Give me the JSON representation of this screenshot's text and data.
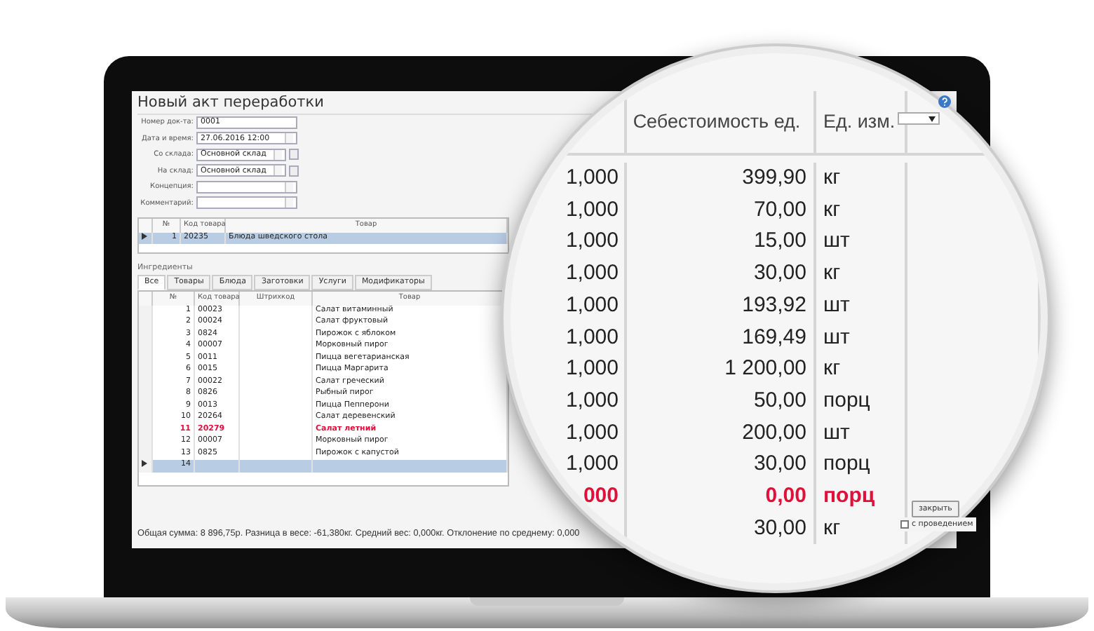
{
  "window": {
    "title": "Новый акт переработки"
  },
  "form": [
    {
      "label": "Номер док-та:",
      "value": "0001",
      "kind": "text"
    },
    {
      "label": "Дата и время:",
      "value": "27.06.2016 12:00",
      "kind": "combo"
    },
    {
      "label": "Со склада:",
      "value": "Основной склад",
      "kind": "lookup"
    },
    {
      "label": "На склад:",
      "value": "Основной склад",
      "kind": "lookup"
    },
    {
      "label": "Концепция:",
      "kind": "combo"
    },
    {
      "label": "Комментарий:",
      "kind": "combo"
    }
  ],
  "products": {
    "columns": [
      "№",
      "Код товара",
      "Товар"
    ],
    "rows": [
      {
        "cells": [
          "1",
          "20235",
          "Блюда шведского стола"
        ],
        "selected": true
      }
    ]
  },
  "ingredients": {
    "title": "Ингредиенты",
    "tabs": [
      {
        "label": "Все",
        "selected": true
      },
      {
        "label": "Товары",
        "selected": false
      },
      {
        "label": "Блюда",
        "selected": false
      },
      {
        "label": "Заготовки",
        "selected": false
      },
      {
        "label": "Услуги",
        "selected": false
      },
      {
        "label": "Модификаторы",
        "selected": false
      }
    ],
    "columns": [
      "№",
      "Код товара",
      "Штрихкод",
      "Товар"
    ],
    "rows": [
      {
        "number": "1",
        "code": "00023",
        "name": "Салат витаминный",
        "highlighted": false,
        "selected": false
      },
      {
        "number": "2",
        "code": "00024",
        "name": "Салат фруктовый",
        "highlighted": false,
        "selected": false
      },
      {
        "number": "3",
        "code": "0824",
        "name": "Пирожок с яблоком",
        "highlighted": false,
        "selected": false
      },
      {
        "number": "4",
        "code": "00007",
        "name": "Морковный пирог",
        "highlighted": false,
        "selected": false
      },
      {
        "number": "5",
        "code": "0011",
        "name": "Пицца вегетарианская",
        "highlighted": false,
        "selected": false
      },
      {
        "number": "6",
        "code": "0015",
        "name": "Пицца Маргарита",
        "highlighted": false,
        "selected": false
      },
      {
        "number": "7",
        "code": "00022",
        "name": "Салат греческий",
        "highlighted": false,
        "selected": false
      },
      {
        "number": "8",
        "code": "0826",
        "name": "Рыбный пирог",
        "highlighted": false,
        "selected": false
      },
      {
        "number": "9",
        "code": "0013",
        "name": "Пицца Пепперони",
        "highlighted": false,
        "selected": false
      },
      {
        "number": "10",
        "code": "20264",
        "name": "Салат деревенский",
        "highlighted": false,
        "selected": false
      },
      {
        "number": "11",
        "code": "20279",
        "name": "Салат летний",
        "highlighted": true,
        "selected": false
      },
      {
        "number": "12",
        "code": "00007",
        "name": "Морковный пирог",
        "highlighted": false,
        "selected": false
      },
      {
        "number": "13",
        "code": "0825",
        "name": "Пирожок с капустой",
        "highlighted": false,
        "selected": false
      },
      {
        "number": "14",
        "selected": true,
        "highlighted": false
      }
    ]
  },
  "status_bar": "Общая сумма: 8 896,75р. Разница в весе: -61,380кг. Средний вес: 0,000кг. Отклонение по среднему: 0,000",
  "footer": {
    "close_button": "закрыть",
    "post_checkbox": {
      "label": "с проведением",
      "checked": false
    }
  },
  "magnifier": {
    "columns": [
      "Себестоимость ед.",
      "Ед. изм."
    ],
    "rows": [
      {
        "quantity": "1,000",
        "cost": "399,90",
        "unit": "кг",
        "highlighted": false
      },
      {
        "quantity": "1,000",
        "cost": "70,00",
        "unit": "кг",
        "highlighted": false
      },
      {
        "quantity": "1,000",
        "cost": "15,00",
        "unit": "шт",
        "highlighted": false
      },
      {
        "quantity": "1,000",
        "cost": "30,00",
        "unit": "кг",
        "highlighted": false
      },
      {
        "quantity": "1,000",
        "cost": "193,92",
        "unit": "шт",
        "highlighted": false
      },
      {
        "quantity": "1,000",
        "cost": "169,49",
        "unit": "шт",
        "highlighted": false
      },
      {
        "quantity": "1,000",
        "cost": "1 200,00",
        "unit": "кг",
        "highlighted": false
      },
      {
        "quantity": "1,000",
        "cost": "50,00",
        "unit": "порц",
        "highlighted": false
      },
      {
        "quantity": "1,000",
        "cost": "200,00",
        "unit": "шт",
        "highlighted": false
      },
      {
        "quantity": "1,000",
        "cost": "30,00",
        "unit": "порц",
        "highlighted": false
      },
      {
        "quantity": "000",
        "cost": "0,00",
        "unit": "порц",
        "highlighted": true
      },
      {
        "cost": "30,00",
        "unit": "кг",
        "highlighted": false
      }
    ]
  }
}
